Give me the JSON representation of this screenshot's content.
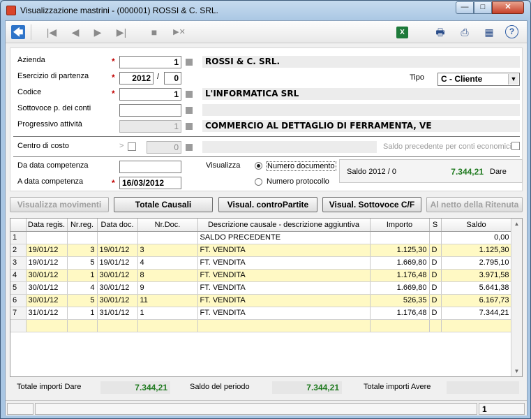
{
  "window": {
    "title": "Visualizzazione mastrini  -  (000001) ROSSI & C. SRL.",
    "minimize": "—",
    "maximize": "□",
    "close": "✕"
  },
  "toolbar": {
    "icons": [
      "back-arrow-icon",
      "first-record-icon",
      "prev-record-icon",
      "next-record-icon",
      "last-record-icon",
      "cut-icon",
      "skip-icon",
      "excel-icon",
      "print-icon",
      "export-icon",
      "calculator-icon",
      "help-icon"
    ],
    "back": "🡄",
    "first": "|◀",
    "prev": "◀",
    "next": "▶",
    "last": "▶|",
    "cut": "■",
    "skip": "▶✕",
    "excel": "X",
    "print": "🖶",
    "export": "⎙",
    "calc": "▦",
    "help": "?"
  },
  "form": {
    "azienda_label": "Azienda",
    "azienda_value": "1",
    "azienda_desc": "ROSSI & C. SRL.",
    "esercizio_label": "Esercizio di partenza",
    "esercizio_value": "2012",
    "esercizio_sep": "/",
    "esercizio_sub": "0",
    "tipo_label": "Tipo",
    "tipo_value": "C  - Cliente",
    "codice_label": "Codice",
    "codice_value": "1",
    "codice_desc": "L'INFORMATICA SRL",
    "sottovoce_label": "Sottovoce p. dei conti",
    "sottovoce_value": "",
    "progressivo_label": "Progressivo attività",
    "progressivo_value": "1",
    "progressivo_desc": "COMMERCIO AL DETTAGLIO DI FERRAMENTA, VE",
    "centro_label": "Centro di costo",
    "centro_arrow": ">",
    "centro_value": "0",
    "saldo_prec_label": "Saldo precedente per conti economici",
    "da_data_label": "Da data competenza",
    "da_data_value": "",
    "a_data_label": "A data competenza",
    "a_data_value": "16/03/2012",
    "visualizza_label": "Visualizza",
    "radio_numero_doc": "Numero documento",
    "radio_numero_prot": "Numero protocollo",
    "saldo_label": "Saldo 2012 / 0",
    "saldo_value": "7.344,21",
    "saldo_side": "Dare"
  },
  "buttons": {
    "visualizza_movimenti": "Visualizza movimenti",
    "totale_causali": "Totale Causali",
    "contropartite": "Visual. controPartite",
    "sottovoce_cf": "Visual. Sottovoce C/F",
    "netto_ritenuta": "Al netto della Ritenuta"
  },
  "grid": {
    "columns": [
      "",
      "Data regis.",
      "Nr.reg.",
      "Data doc.",
      "Nr.Doc.",
      "Descrizione causale - descrizione aggiuntiva",
      "Importo",
      "S",
      "Saldo"
    ],
    "rows": [
      {
        "n": "1",
        "data_reg": "",
        "nr_reg": "",
        "data_doc": "",
        "nr_doc": "",
        "descr": "SALDO PRECEDENTE",
        "importo": "",
        "s": "",
        "saldo": "0,00",
        "hl": false
      },
      {
        "n": "2",
        "data_reg": "19/01/12",
        "nr_reg": "3",
        "data_doc": "19/01/12",
        "nr_doc": "3",
        "descr": "FT. VENDITA",
        "importo": "1.125,30",
        "s": "D",
        "saldo": "1.125,30",
        "hl": true
      },
      {
        "n": "3",
        "data_reg": "19/01/12",
        "nr_reg": "5",
        "data_doc": "19/01/12",
        "nr_doc": "4",
        "descr": "FT. VENDITA",
        "importo": "1.669,80",
        "s": "D",
        "saldo": "2.795,10",
        "hl": false
      },
      {
        "n": "4",
        "data_reg": "30/01/12",
        "nr_reg": "1",
        "data_doc": "30/01/12",
        "nr_doc": "8",
        "descr": "FT. VENDITA",
        "importo": "1.176,48",
        "s": "D",
        "saldo": "3.971,58",
        "hl": true
      },
      {
        "n": "5",
        "data_reg": "30/01/12",
        "nr_reg": "4",
        "data_doc": "30/01/12",
        "nr_doc": "9",
        "descr": "FT. VENDITA",
        "importo": "1.669,80",
        "s": "D",
        "saldo": "5.641,38",
        "hl": false
      },
      {
        "n": "6",
        "data_reg": "30/01/12",
        "nr_reg": "5",
        "data_doc": "30/01/12",
        "nr_doc": "11",
        "descr": "FT. VENDITA",
        "importo": "526,35",
        "s": "D",
        "saldo": "6.167,73",
        "hl": true
      },
      {
        "n": "7",
        "data_reg": "31/01/12",
        "nr_reg": "1",
        "data_doc": "31/01/12",
        "nr_doc": "1",
        "descr": "FT. VENDITA",
        "importo": "1.176,48",
        "s": "D",
        "saldo": "7.344,21",
        "hl": false
      },
      {
        "n": "",
        "data_reg": "",
        "nr_reg": "",
        "data_doc": "",
        "nr_doc": "",
        "descr": "",
        "importo": "",
        "s": "",
        "saldo": "",
        "hl": true
      }
    ]
  },
  "totals": {
    "dare_label": "Totale importi Dare",
    "dare_value": "7.344,21",
    "periodo_label": "Saldo del periodo",
    "periodo_value": "7.344,21",
    "avere_label": "Totale importi Avere",
    "avere_value": ""
  },
  "status": {
    "cell1": "",
    "cell2": "",
    "record": "1"
  }
}
